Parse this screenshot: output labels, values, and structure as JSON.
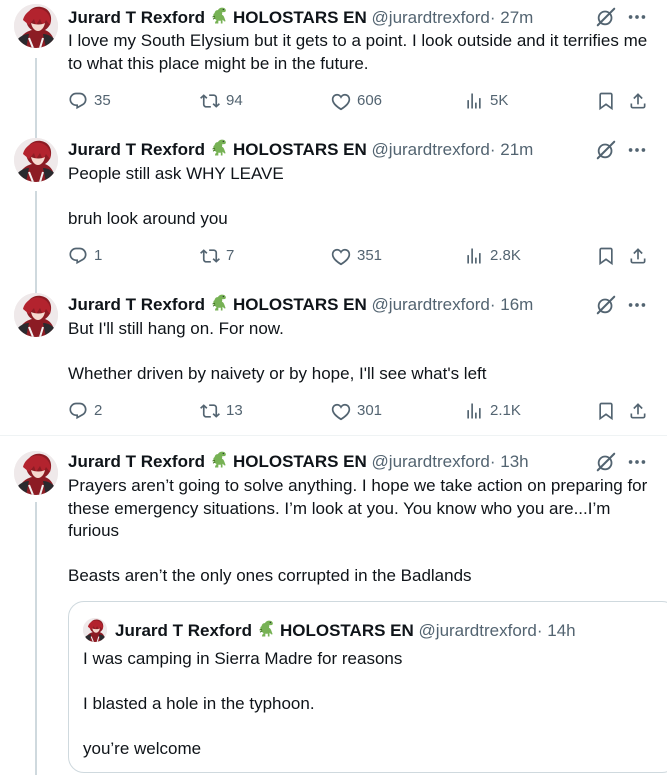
{
  "author": {
    "name": "Jurard T Rexford",
    "org": "HOLOSTARS EN",
    "handle": "@jurardtrexford"
  },
  "tweets": [
    {
      "time": "· 27m",
      "lines": [
        "I love my South Elysium but it gets to a point. I look outside and it terrifies me to what this place might be in the future."
      ],
      "stats": {
        "replies": "35",
        "retweets": "94",
        "likes": "606",
        "views": "5K"
      }
    },
    {
      "time": "· 21m",
      "lines": [
        "People still ask WHY LEAVE",
        "",
        "bruh look around you"
      ],
      "stats": {
        "replies": "1",
        "retweets": "7",
        "likes": "351",
        "views": "2.8K"
      }
    },
    {
      "time": "· 16m",
      "lines": [
        "But I'll still hang on. For now.",
        "",
        "Whether driven by naivety or by hope,  I'll see what's left"
      ],
      "stats": {
        "replies": "2",
        "retweets": "13",
        "likes": "301",
        "views": "2.1K"
      }
    },
    {
      "time": "· 13h",
      "lines": [
        "Prayers aren’t going to solve anything. I hope we take action on preparing for these emergency situations. I’m look at you. You know who you are...I’m furious",
        "",
        "Beasts aren’t the only ones corrupted in the Badlands"
      ]
    }
  ],
  "quote": {
    "time": "· 14h",
    "lines": [
      "I was camping in Sierra Madre for reasons",
      "",
      "I blasted a hole in the typhoon.",
      "",
      "you’re welcome"
    ]
  },
  "colors": {
    "text": "#0f1419",
    "muted": "#536471",
    "line": "#cfd9de",
    "divider": "#eff3f4"
  },
  "icons": [
    "reply-icon",
    "retweet-icon",
    "like-icon",
    "views-icon",
    "bookmark-icon",
    "share-icon",
    "grok-icon",
    "more-icon",
    "dinosaur-emoji"
  ]
}
